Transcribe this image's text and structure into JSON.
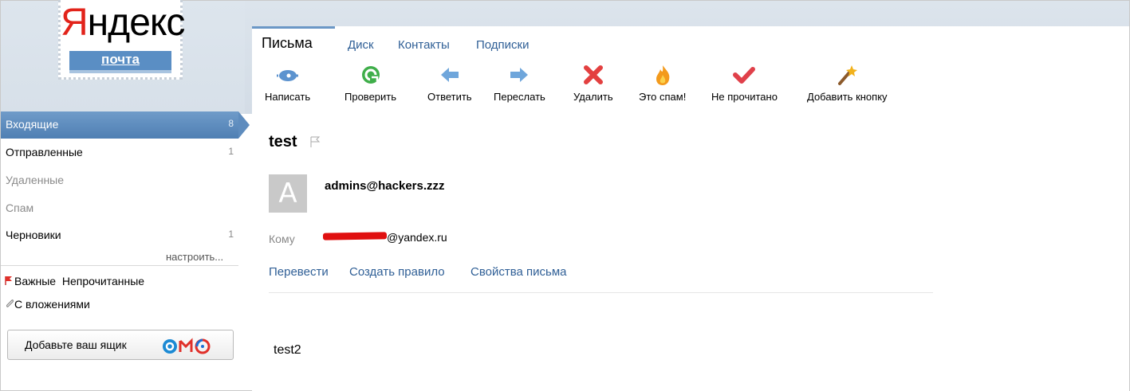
{
  "logo": {
    "brand_first": "Я",
    "brand_rest": "ндекс",
    "service": "почта"
  },
  "tabs": [
    {
      "label": "Письма",
      "active": true
    },
    {
      "label": "Диск"
    },
    {
      "label": "Контакты"
    },
    {
      "label": "Подписки"
    }
  ],
  "toolbar": [
    {
      "label": "Написать",
      "icon": "compose-pen-icon"
    },
    {
      "label": "Проверить",
      "icon": "refresh-icon"
    },
    {
      "label": "Ответить",
      "icon": "reply-arrow-icon"
    },
    {
      "label": "Переслать",
      "icon": "forward-arrow-icon"
    },
    {
      "label": "Удалить",
      "icon": "delete-x-icon"
    },
    {
      "label": "Это спам!",
      "icon": "spam-fire-icon"
    },
    {
      "label": "Не прочитано",
      "icon": "unread-check-icon"
    },
    {
      "label": "Добавить кнопку",
      "icon": "magic-wand-icon"
    }
  ],
  "sidebar": {
    "folders": [
      {
        "name": "Входящие",
        "count": "8"
      },
      {
        "name": "Отправленные",
        "count": "1"
      },
      {
        "name": "Удаленные",
        "count": ""
      },
      {
        "name": "Спам",
        "count": ""
      },
      {
        "name": "Черновики",
        "count": "1"
      }
    ],
    "configure": "настроить...",
    "filter_important": "Важные",
    "filter_unread": "Непрочитанные",
    "filter_attachments": "С вложениями",
    "add_mailbox": "Добавьте ваш ящик"
  },
  "message": {
    "subject": "test",
    "avatar_letter": "A",
    "sender": "admins@hackers.zzz",
    "to_label": "Кому",
    "to_domain": "@yandex.ru",
    "actions": [
      "Перевести",
      "Создать правило",
      "Свойства письма"
    ],
    "body": "test2"
  },
  "colors": {
    "accent_blue": "#5a8ec4",
    "link_blue": "#2f5f96",
    "logo_red": "#e2231a",
    "top_band": "#d7e0e9"
  }
}
